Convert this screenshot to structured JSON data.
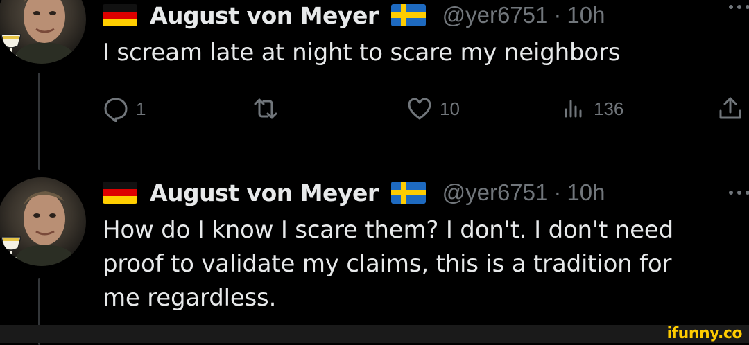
{
  "tweets": [
    {
      "author": {
        "name": "August von Meyer",
        "handle": "@yer6751",
        "timestamp": "10h",
        "separator": "·",
        "flags": [
          "germany-flag",
          "sweden-flag"
        ]
      },
      "text": "I scream late at night to scare my neighbors",
      "actions": {
        "reply_count": "1",
        "retweet_count": "",
        "like_count": "10",
        "views_count": "136"
      }
    },
    {
      "author": {
        "name": "August von Meyer",
        "handle": "@yer6751",
        "timestamp": "10h",
        "separator": "·",
        "flags": [
          "germany-flag",
          "sweden-flag"
        ]
      },
      "text": "How do I know I scare them? I don't. I don't need proof to validate my claims, this is a tradition for me regardless."
    }
  ],
  "colors": {
    "background": "#000000",
    "text_primary": "#e7e9ea",
    "text_secondary": "#71767b",
    "thread_line": "#333639",
    "watermark": "#ffcc00"
  },
  "icons": {
    "reply": "reply-icon",
    "retweet": "retweet-icon",
    "like": "heart-icon",
    "views": "views-icon",
    "share": "share-icon",
    "more": "more-icon"
  },
  "watermark": {
    "text": "ifunny.co"
  }
}
